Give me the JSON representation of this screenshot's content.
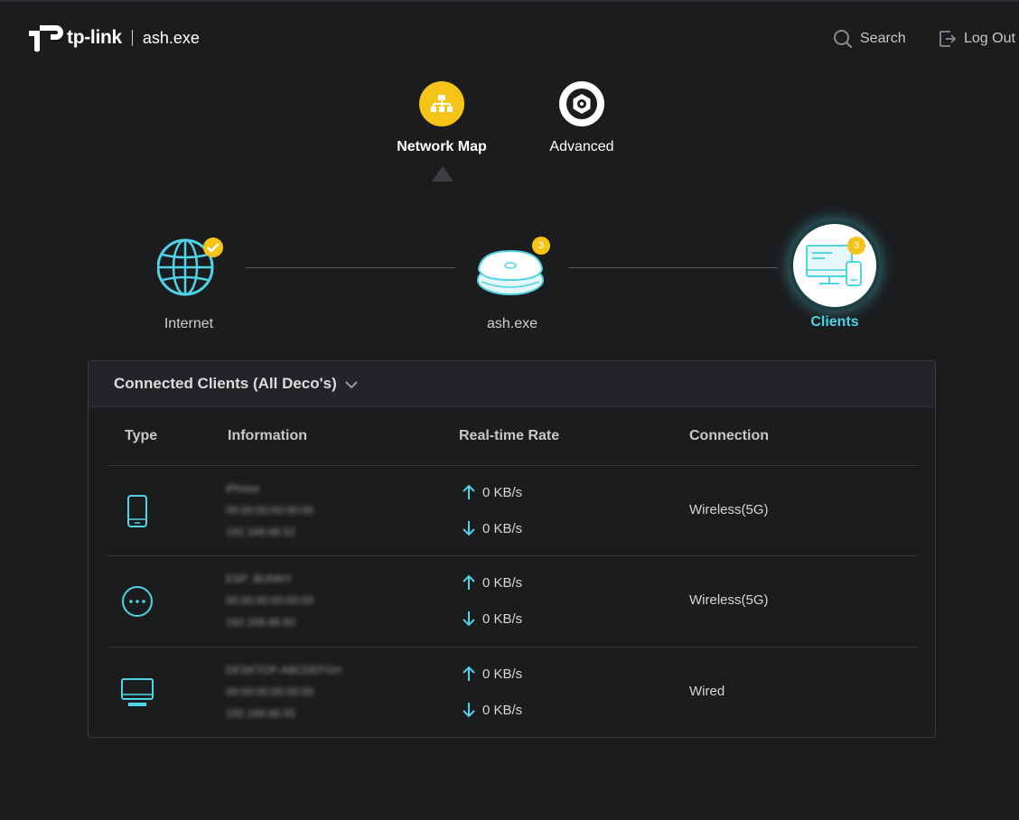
{
  "header": {
    "brand": "tp-link",
    "site_name": "ash.exe",
    "search_label": "Search",
    "logout_label": "Log Out"
  },
  "nav": {
    "network_map": "Network Map",
    "advanced": "Advanced"
  },
  "topology": {
    "internet_label": "Internet",
    "deco_label": "ash.exe",
    "deco_badge": "3",
    "clients_label": "Clients",
    "clients_badge": "3"
  },
  "panel": {
    "title": "Connected Clients (All Deco's)",
    "columns": {
      "type": "Type",
      "information": "Information",
      "rate": "Real-time Rate",
      "connection": "Connection"
    },
    "rows": [
      {
        "type_icon": "phone-icon",
        "info": [
          "iPhone",
          "00:00:00:00:00:00",
          "192.168.68.52"
        ],
        "up": "0 KB/s",
        "down": "0 KB/s",
        "connection": "Wireless(5G)"
      },
      {
        "type_icon": "other-device-icon",
        "info": [
          "ESP_BUNNY",
          "00:00:00:00:00:00",
          "192.168.68.60"
        ],
        "up": "0 KB/s",
        "down": "0 KB/s",
        "connection": "Wireless(5G)"
      },
      {
        "type_icon": "computer-icon",
        "info": [
          "DESKTOP-ABCDEFGH",
          "00:00:00:00:00:00",
          "192.168.68.55"
        ],
        "up": "0 KB/s",
        "down": "0 KB/s",
        "connection": "Wired"
      }
    ]
  },
  "colors": {
    "accent_yellow": "#f6c417",
    "accent_cyan": "#4fd3e6",
    "background": "#1b1c1e"
  }
}
